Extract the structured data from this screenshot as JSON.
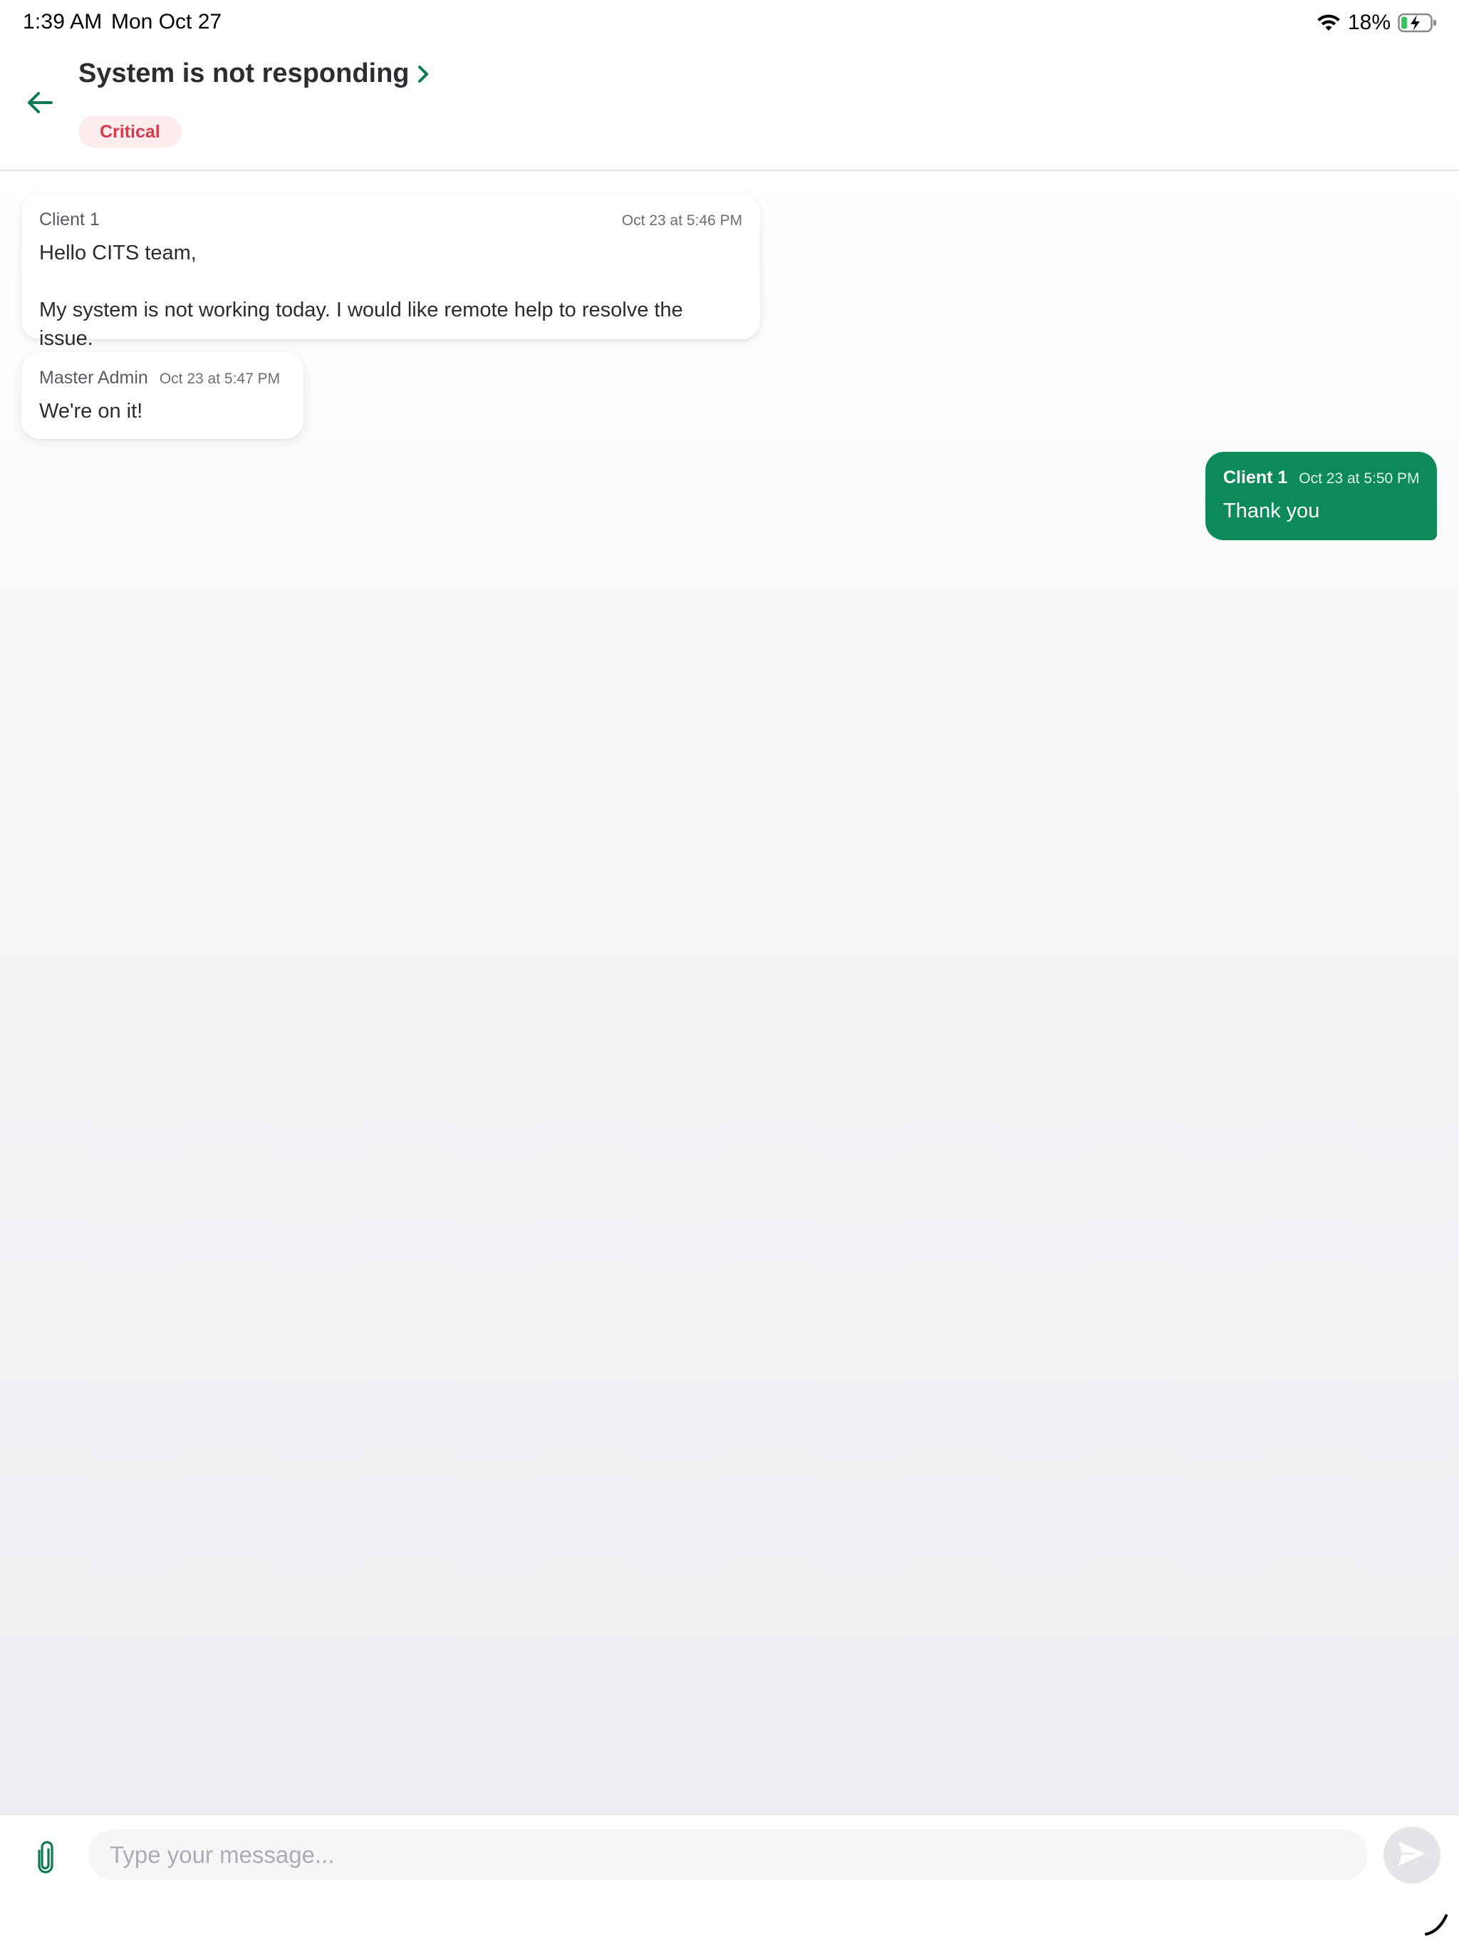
{
  "status_bar": {
    "time": "1:39 AM",
    "date": "Mon Oct 27",
    "battery_percent": "18%",
    "wifi_icon": "wifi-icon",
    "battery_icon": "battery-charging-icon"
  },
  "header": {
    "back_icon": "arrow-left-icon",
    "title": "System is not responding",
    "chevron_icon": "chevron-right-icon",
    "priority": "Critical"
  },
  "messages": [
    {
      "sender": "Client 1",
      "timestamp": "Oct 23 at 5:46 PM",
      "body": "Hello CITS team,\n\nMy system is not working today. I would like remote help to resolve the issue.",
      "direction": "incoming"
    },
    {
      "sender": "Master Admin",
      "timestamp": "Oct 23 at 5:47 PM",
      "body": "We're on it!",
      "direction": "incoming"
    },
    {
      "sender": "Client 1",
      "timestamp": "Oct 23 at 5:50 PM",
      "body": "Thank you",
      "direction": "outgoing"
    }
  ],
  "composer": {
    "attach_icon": "paperclip-icon",
    "placeholder": "Type your message...",
    "value": "",
    "send_icon": "send-icon"
  },
  "colors": {
    "accent": "#0c8a5a",
    "critical_text": "#d93a4a",
    "critical_bg": "#fdecee",
    "outgoing_bubble": "#0c8a5a",
    "incoming_bubble": "#ffffff"
  }
}
